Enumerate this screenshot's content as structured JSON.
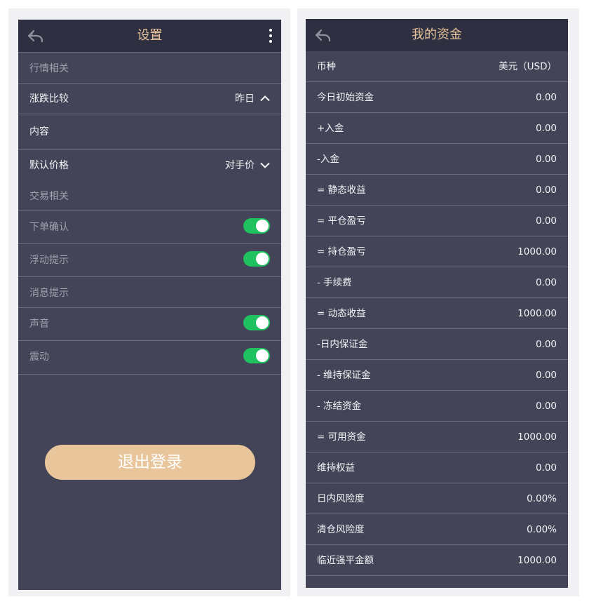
{
  "settings": {
    "title": "设置",
    "sections": {
      "market": "行情相关",
      "trade": "交易相关",
      "message": "消息提示"
    },
    "rows": {
      "change_compare": {
        "label": "涨跌比较",
        "value": "昨日"
      },
      "content": {
        "label": "内容"
      },
      "default_price": {
        "label": "默认价格",
        "value": "对手价"
      },
      "order_confirm": {
        "label": "下单确认",
        "enabled": true
      },
      "float_tip": {
        "label": "浮动提示",
        "enabled": true
      },
      "sound": {
        "label": "声音",
        "enabled": true
      },
      "vibrate": {
        "label": "震动",
        "enabled": true
      }
    },
    "logout_label": "退出登录",
    "icons": {
      "back": "back-arrow-icon",
      "more": "more-vertical-icon",
      "up": "chevron-up-icon",
      "down": "chevron-down-icon"
    }
  },
  "funds": {
    "title": "我的资金",
    "rows": [
      {
        "label": "币种",
        "value": "美元（USD）"
      },
      {
        "label": "今日初始资金",
        "value": "0.00"
      },
      {
        "label": "+入金",
        "value": "0.00"
      },
      {
        "label": "-入金",
        "value": "0.00"
      },
      {
        "label": "= 静态收益",
        "value": "0.00"
      },
      {
        "label": "= 平仓盈亏",
        "value": "0.00"
      },
      {
        "label": "= 持仓盈亏",
        "value": "1000.00"
      },
      {
        "label": "- 手续费",
        "value": "0.00"
      },
      {
        "label": "= 动态收益",
        "value": "1000.00"
      },
      {
        "label": "-日内保证金",
        "value": "0.00"
      },
      {
        "label": "- 维持保证金",
        "value": "0.00"
      },
      {
        "label": "- 冻结资金",
        "value": "0.00"
      },
      {
        "label": "= 可用资金",
        "value": "1000.00"
      },
      {
        "label": "维持权益",
        "value": "0.00"
      },
      {
        "label": "日内风险度",
        "value": "0.00%"
      },
      {
        "label": "清仓风险度",
        "value": "0.00%"
      },
      {
        "label": "临近强平金额",
        "value": "1000.00"
      }
    ]
  },
  "colors": {
    "panel_bg": "#434457",
    "header_bg": "#2e2f41",
    "accent": "#e8c49a",
    "toggle_on": "#1fc25e",
    "logout_bg": "#e8c59b"
  }
}
